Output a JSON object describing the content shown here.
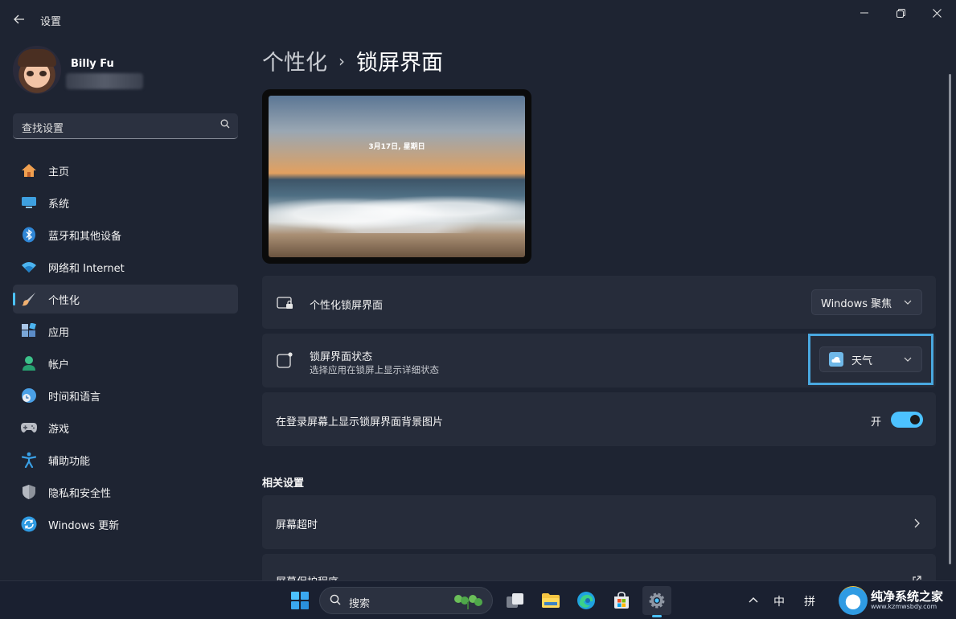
{
  "window": {
    "title": "设置",
    "back_icon": "arrow-left-icon",
    "controls": [
      "minimize-icon",
      "restore-icon",
      "close-icon"
    ]
  },
  "profile": {
    "name": "Billy Fu"
  },
  "search": {
    "placeholder": "查找设置"
  },
  "sidebar": {
    "items": [
      {
        "label": "主页",
        "icon": "home-icon",
        "color": "#f0a050"
      },
      {
        "label": "系统",
        "icon": "monitor-icon",
        "color": "#3ea0e0"
      },
      {
        "label": "蓝牙和其他设备",
        "icon": "bluetooth-icon",
        "color": "#2f86d6"
      },
      {
        "label": "网络和 Internet",
        "icon": "wifi-icon",
        "color": "#4cb4f0"
      },
      {
        "label": "个性化",
        "icon": "brush-icon",
        "color": "#f0b070",
        "active": true
      },
      {
        "label": "应用",
        "icon": "apps-icon",
        "color": "#7aa7d8"
      },
      {
        "label": "帐户",
        "icon": "person-icon",
        "color": "#3cc28a"
      },
      {
        "label": "时间和语言",
        "icon": "clock-globe-icon",
        "color": "#4aa0e6"
      },
      {
        "label": "游戏",
        "icon": "gamepad-icon",
        "color": "#b9bcc4"
      },
      {
        "label": "辅助功能",
        "icon": "accessibility-icon",
        "color": "#3aa0e6"
      },
      {
        "label": "隐私和安全性",
        "icon": "shield-icon",
        "color": "#8e939c"
      },
      {
        "label": "Windows 更新",
        "icon": "update-icon",
        "color": "#2f9be3"
      }
    ]
  },
  "main": {
    "breadcrumb": {
      "parent": "个性化",
      "separator": "›",
      "current": "锁屏界面"
    },
    "preview": {
      "date_text": "3月17日, 星期日"
    },
    "cards": {
      "personalize": {
        "title": "个性化锁屏界面",
        "dropdown_value": "Windows 聚焦"
      },
      "status": {
        "title": "锁屏界面状态",
        "subtitle": "选择应用在锁屏上显示详细状态",
        "dropdown_value": "天气"
      },
      "signin_bg": {
        "title": "在登录屏幕上显示锁屏界面背景图片",
        "toggle_label": "开",
        "toggle_on": true
      }
    },
    "related": {
      "title": "相关设置",
      "items": [
        {
          "label": "屏幕超时",
          "icon": "chevron-right-icon"
        },
        {
          "label": "屏幕保护程序",
          "icon": "external-link-icon"
        }
      ]
    }
  },
  "taskbar": {
    "search_label": "搜索",
    "tray": {
      "ime1": "中",
      "ime2": "拼"
    },
    "watermark": {
      "title": "纯净系统之家",
      "url": "www.kzmwsbdy.com"
    }
  },
  "colors": {
    "accent": "#4cc2ff",
    "highlight_border": "#49a8e0"
  }
}
